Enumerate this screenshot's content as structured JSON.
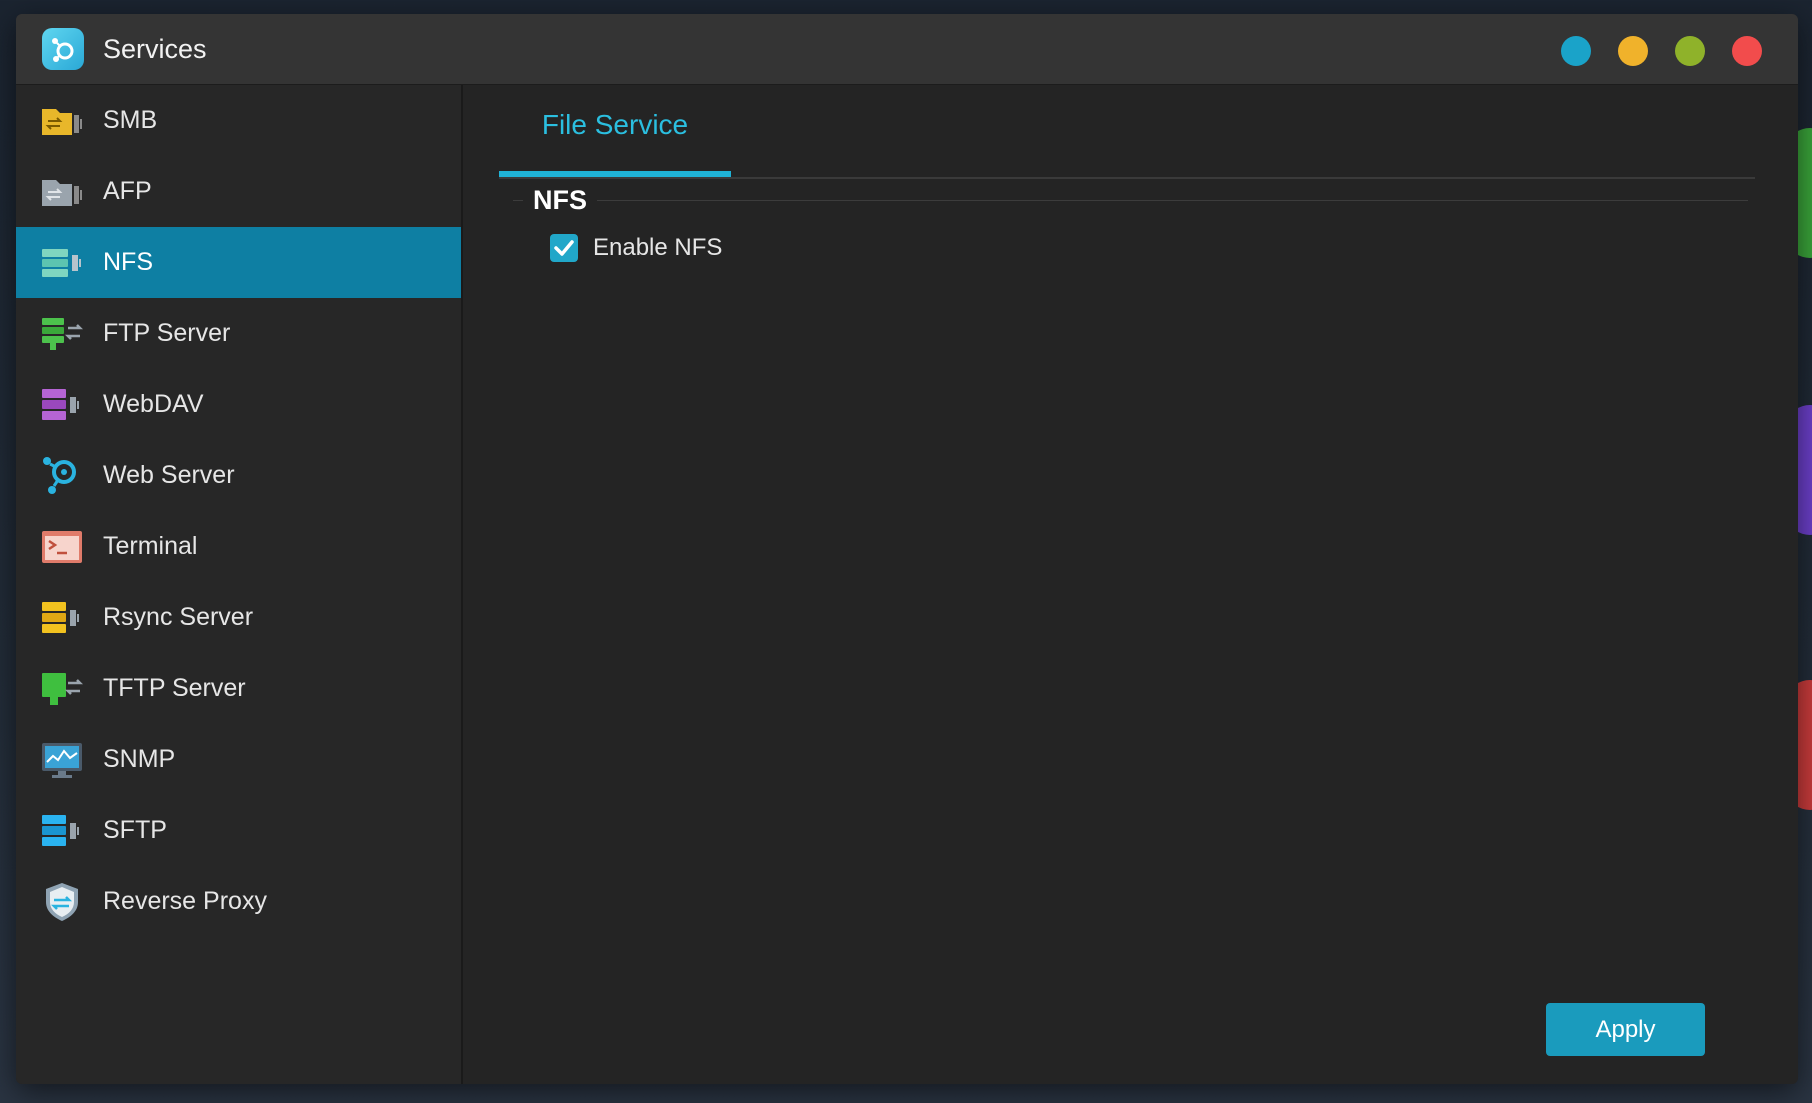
{
  "window": {
    "title": "Services",
    "controls": [
      {
        "name": "info",
        "color": "#1aa3c9"
      },
      {
        "name": "minimize",
        "color": "#f0b22b"
      },
      {
        "name": "maximize",
        "color": "#8fb22a"
      },
      {
        "name": "close",
        "color": "#f24c4c"
      }
    ]
  },
  "sidebar": {
    "items": [
      {
        "id": "smb",
        "label": "SMB",
        "icon": "smb-icon",
        "active": false
      },
      {
        "id": "afp",
        "label": "AFP",
        "icon": "afp-icon",
        "active": false
      },
      {
        "id": "nfs",
        "label": "NFS",
        "icon": "nfs-icon",
        "active": true
      },
      {
        "id": "ftp",
        "label": "FTP Server",
        "icon": "ftp-server-icon",
        "active": false
      },
      {
        "id": "webdav",
        "label": "WebDAV",
        "icon": "webdav-icon",
        "active": false
      },
      {
        "id": "webserver",
        "label": "Web Server",
        "icon": "web-server-icon",
        "active": false
      },
      {
        "id": "terminal",
        "label": "Terminal",
        "icon": "terminal-icon",
        "active": false
      },
      {
        "id": "rsync",
        "label": "Rsync Server",
        "icon": "rsync-server-icon",
        "active": false
      },
      {
        "id": "tftp",
        "label": "TFTP Server",
        "icon": "tftp-server-icon",
        "active": false
      },
      {
        "id": "snmp",
        "label": "SNMP",
        "icon": "snmp-icon",
        "active": false
      },
      {
        "id": "sftp",
        "label": "SFTP",
        "icon": "sftp-icon",
        "active": false
      },
      {
        "id": "reverseproxy",
        "label": "Reverse Proxy",
        "icon": "reverse-proxy-icon",
        "active": false
      }
    ]
  },
  "main": {
    "tabs": [
      {
        "label": "File Service",
        "active": true
      }
    ],
    "section": {
      "title": "NFS",
      "enable_label": "Enable NFS",
      "enabled": true
    },
    "apply_label": "Apply"
  },
  "colors": {
    "accent": "#1fb2d6",
    "active_item": "#0e7fa3",
    "apply_button": "#1a9bbd"
  }
}
